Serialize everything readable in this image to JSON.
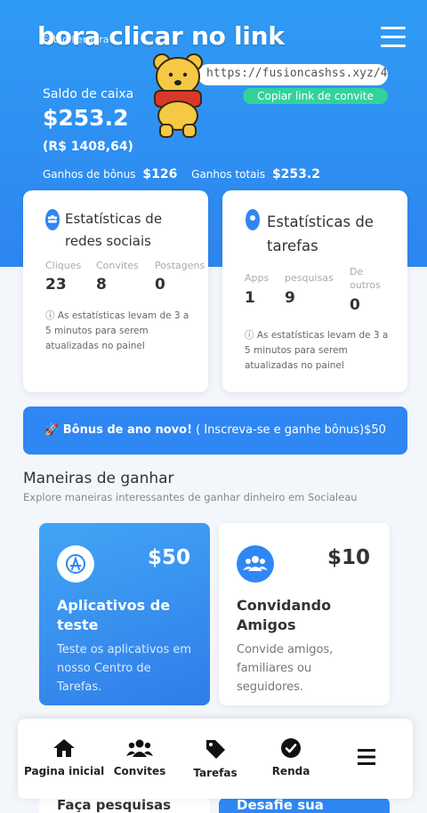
{
  "overlay": {
    "caption": "bora clicar no link",
    "username": "Fábio Ferreira"
  },
  "header": {
    "referral_url": "https://fusioncashss.xyz/484",
    "copy_label": "Copiar link de convite",
    "cash_label": "Saldo de caixa",
    "cash_value": "$253.2",
    "cash_brl": "(R$ 1408,64)",
    "bonus_label": "Ganhos de bônus",
    "bonus_value": "$126",
    "total_label": "Ganhos totais",
    "total_value": "$253.2"
  },
  "social_stats": {
    "title_line1": "Estatísticas de",
    "title_line2": "redes sociais",
    "items": [
      {
        "label": "Cliques",
        "value": "23"
      },
      {
        "label": "Convites",
        "value": "8"
      },
      {
        "label": "Postagens",
        "value": "0"
      }
    ],
    "note": [
      "ⓘ As estatísticas levam de 3 a",
      "5 minutos para serem",
      "atualizadas no painel"
    ]
  },
  "task_stats": {
    "title_line1": "Estatísticas de",
    "title_line2": "tarefas",
    "items": [
      {
        "label": "Apps",
        "value": "1"
      },
      {
        "label": "pesquisas",
        "value": "9"
      },
      {
        "label": "De",
        "label2": "outros",
        "value": "0"
      }
    ],
    "note": [
      "ⓘ As estatísticas levam de 3 a",
      "5 minutos para serem",
      "atualizadas no painel"
    ]
  },
  "banner": {
    "bold": "🚀 Bônus de ano novo!",
    "rest": " ( Inscreva-se e ganhe bônus)$50"
  },
  "ways": {
    "title": "Maneiras de ganhar",
    "subtitle": "Explore maneiras interessantes de ganhar dinheiro em Socialeau",
    "cards": [
      {
        "amount": "$50",
        "title": "Aplicativos de teste",
        "desc": "Teste os aplicativos em nosso Centro de Tarefas.",
        "icon": "app-store-icon"
      },
      {
        "amount": "$10",
        "title": "Convidando Amigos",
        "desc": "Convide amigos, familiares ou seguidores.",
        "icon": "users-icon"
      }
    ],
    "peek_left": "Faça pesquisas",
    "peek_right": "Desafie sua"
  },
  "nav": [
    {
      "label": "Pagina inicial",
      "icon": "home-icon"
    },
    {
      "label": "Convites",
      "icon": "users-icon"
    },
    {
      "label": "Tarefas",
      "icon": "tag-icon"
    },
    {
      "label": "Renda",
      "icon": "check-circle-icon"
    },
    {
      "label": "",
      "icon": "menu-icon"
    }
  ],
  "colors": {
    "primary": "#2f87f3",
    "accent_green": "#33d29a",
    "text_dark": "#333333"
  }
}
